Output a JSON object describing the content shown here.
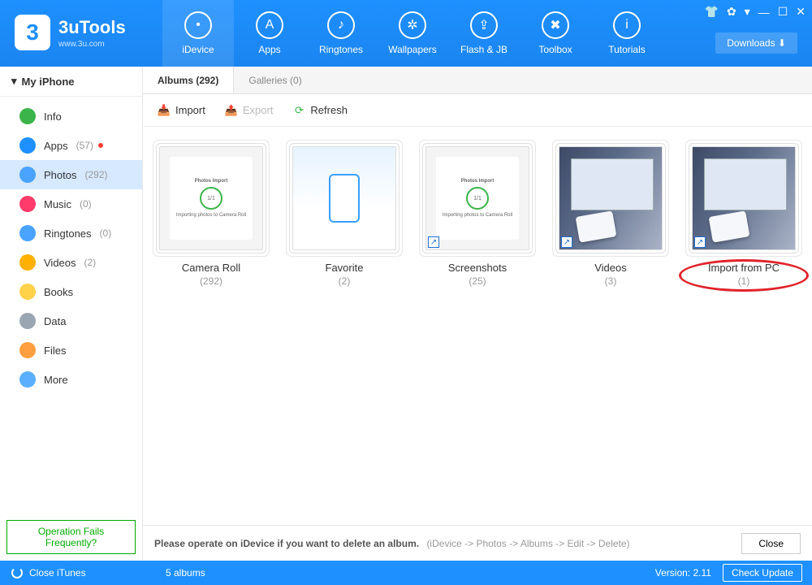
{
  "app": {
    "name": "3uTools",
    "site": "www.3u.com"
  },
  "nav": [
    {
      "label": "iDevice",
      "active": true
    },
    {
      "label": "Apps"
    },
    {
      "label": "Ringtones"
    },
    {
      "label": "Wallpapers"
    },
    {
      "label": "Flash & JB"
    },
    {
      "label": "Toolbox"
    },
    {
      "label": "Tutorials"
    }
  ],
  "downloads_label": "Downloads",
  "device_name": "My iPhone",
  "sidebar": [
    {
      "label": "Info",
      "count": "",
      "color": "#3bb54a"
    },
    {
      "label": "Apps",
      "count": "(57)",
      "color": "#1e90ff",
      "badge": true
    },
    {
      "label": "Photos",
      "count": "(292)",
      "color": "#4aa3ff",
      "active": true
    },
    {
      "label": "Music",
      "count": "(0)",
      "color": "#ff3b6b"
    },
    {
      "label": "Ringtones",
      "count": "(0)",
      "color": "#4aa3ff"
    },
    {
      "label": "Videos",
      "count": "(2)",
      "color": "#ffb000"
    },
    {
      "label": "Books",
      "count": "",
      "color": "#ffd24a"
    },
    {
      "label": "Data",
      "count": "",
      "color": "#9aa6b2"
    },
    {
      "label": "Files",
      "count": "",
      "color": "#ff9f40"
    },
    {
      "label": "More",
      "count": "",
      "color": "#5ab0ff"
    }
  ],
  "op_fails": "Operation Fails Frequently?",
  "tabs": [
    {
      "label": "Albums (292)",
      "active": true
    },
    {
      "label": "Galleries (0)"
    }
  ],
  "toolbar": {
    "import": "Import",
    "export": "Export",
    "refresh": "Refresh"
  },
  "albums": [
    {
      "name": "Camera Roll",
      "count": "(292)",
      "kind": "import"
    },
    {
      "name": "Favorite",
      "count": "(2)",
      "kind": "fav"
    },
    {
      "name": "Screenshots",
      "count": "(25)",
      "kind": "import",
      "shortcut": true
    },
    {
      "name": "Videos",
      "count": "(3)",
      "kind": "desk",
      "shortcut": true
    },
    {
      "name": "Import from PC",
      "count": "(1)",
      "kind": "desk",
      "shortcut": true,
      "highlight": true
    }
  ],
  "info": {
    "text": "Please operate on iDevice if you want to delete an album.",
    "path": "(iDevice -> Photos -> Albums -> Edit -> Delete)",
    "close": "Close"
  },
  "footer": {
    "close_itunes": "Close iTunes",
    "album_count": "5 albums",
    "version": "Version: 2.11",
    "check_update": "Check Update"
  }
}
